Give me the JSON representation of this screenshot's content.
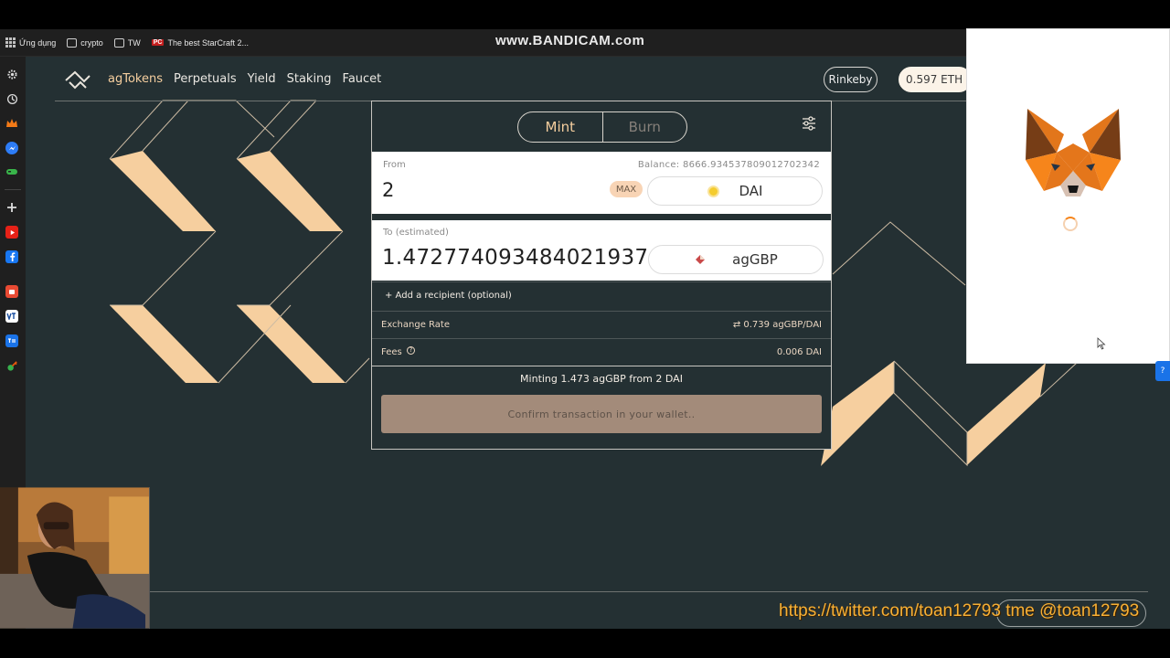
{
  "watermark_top": "www.BANDICAM.com",
  "bookmarks": [
    {
      "label": "Ứng dụng",
      "icon": "apps-grid-icon"
    },
    {
      "label": "crypto",
      "icon": "folder-icon"
    },
    {
      "label": "TW",
      "icon": "folder-icon"
    },
    {
      "label": "The best StarCraft 2...",
      "icon": "pc-site-icon"
    }
  ],
  "nav": {
    "links": [
      "agTokens",
      "Perpetuals",
      "Yield",
      "Staking",
      "Faucet"
    ],
    "active": "agTokens",
    "network": "Rinkeby",
    "balance": "0.597 ETH"
  },
  "card": {
    "tabs": {
      "mint": "Mint",
      "burn": "Burn"
    },
    "from": {
      "label": "From",
      "balance": "Balance: 8666.934537809012702342",
      "amount": "2",
      "max": "MAX",
      "token": "DAI"
    },
    "to": {
      "label": "To (estimated)",
      "amount": "1.472774093484021937",
      "token": "agGBP"
    },
    "recipient": "+ Add a recipient (optional)",
    "rate": {
      "label": "Exchange Rate",
      "value": "⇄ 0.739 agGBP/DAI"
    },
    "fees": {
      "label": "Fees",
      "value": "0.006 DAI"
    },
    "summary": "Minting 1.473 agGBP from 2 DAI",
    "confirm": "Confirm transaction in your wallet.."
  },
  "colors": {
    "background": "#243033",
    "accent": "#f6cf9f",
    "confirm_button": "#a38b7a",
    "metamask_orange": "#f6851b"
  },
  "overlay_text": "https://twitter.com/toan12793 tme @toan12793"
}
